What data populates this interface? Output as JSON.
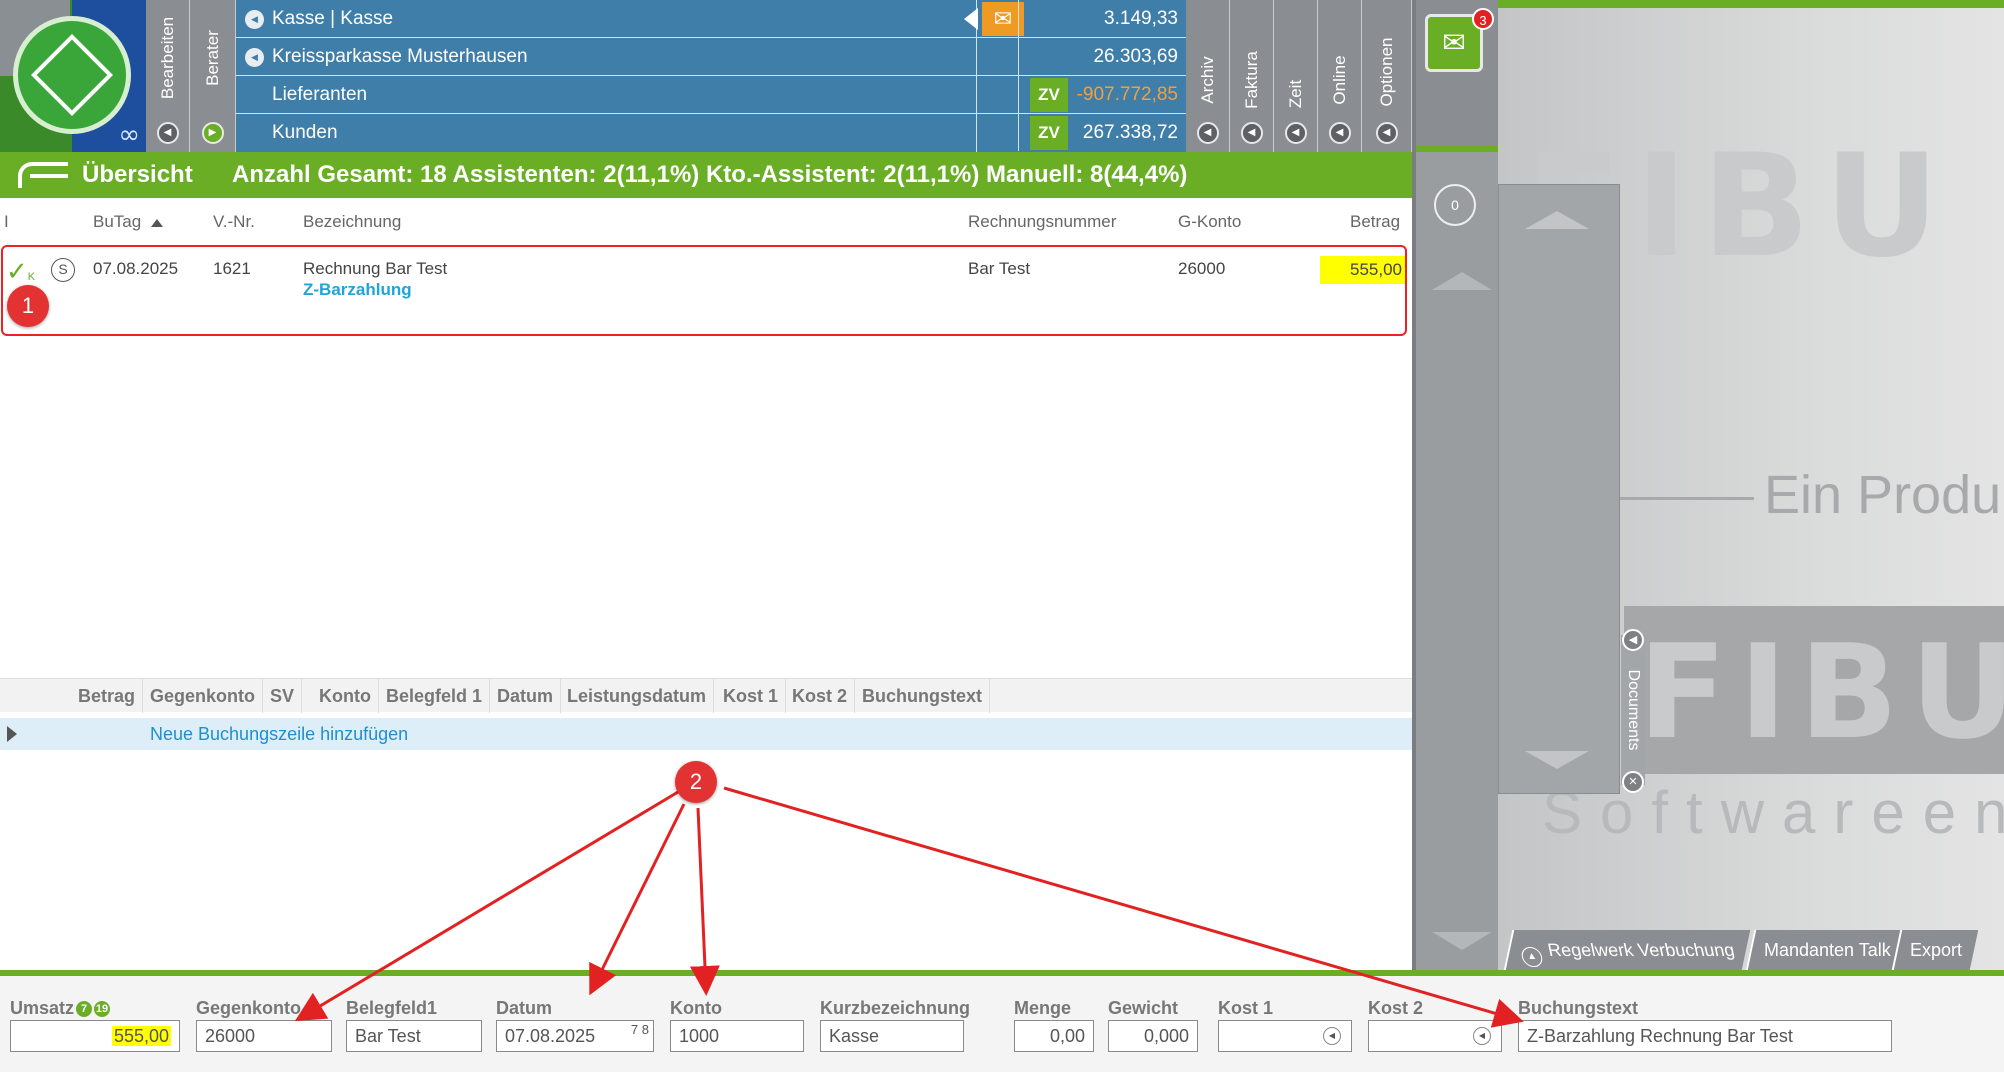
{
  "sidebar_tabs": [
    {
      "label": "Bearbeiten"
    },
    {
      "label": "Berater"
    }
  ],
  "accounts": [
    {
      "name": "Kasse | Kasse",
      "value": "3.149,33",
      "has_mail": true
    },
    {
      "name": "Kreissparkasse Musterhausen",
      "value": "26.303,69"
    },
    {
      "name": "Lieferanten",
      "value": "-907.772,85",
      "zv": "ZV"
    },
    {
      "name": "Kunden",
      "value": "267.338,72",
      "zv": "ZV"
    }
  ],
  "right_tabs": [
    {
      "label": "Archiv"
    },
    {
      "label": "Faktura"
    },
    {
      "label": "Zeit"
    },
    {
      "label": "Online"
    },
    {
      "label": "Optionen"
    }
  ],
  "inbox": {
    "badge": "3",
    "counter": "0"
  },
  "overview": {
    "title": "Übersicht",
    "stats": "Anzahl Gesamt: 18  Assistenten: 2(11,1%)  Kto.-Assistent: 2(11,1%)  Manuell: 8(44,4%)"
  },
  "table": {
    "headers": {
      "i": "I",
      "butag": "BuTag",
      "vnr": "V.-Nr.",
      "bezeichnung": "Bezeichnung",
      "rechnungsnummer": "Rechnungsnummer",
      "gkonto": "G-Konto",
      "betrag": "Betrag"
    },
    "rows": [
      {
        "status_mark": "✓K",
        "s": "S",
        "butag": "07.08.2025",
        "vnr": "1621",
        "bezeichnung": "Rechnung Bar Test",
        "sub": "Z-Barzahlung",
        "rechnungsnummer": "Bar Test",
        "gkonto": "26000",
        "betrag": "555,00"
      }
    ]
  },
  "booking_columns": [
    "Betrag",
    "Gegenkonto",
    "SV",
    "Konto",
    "Belegfeld 1",
    "Datum",
    "Leistungsdatum",
    "Kost 1",
    "Kost 2",
    "Buchungstext"
  ],
  "new_line_link": "Neue Buchungszeile hinzufügen",
  "form": {
    "umsatz": {
      "label": "Umsatz",
      "value": "555,00",
      "badge1": "7",
      "badge2": "19"
    },
    "gegenkonto": {
      "label": "Gegenkonto",
      "value": "26000"
    },
    "belegfeld1": {
      "label": "Belegfeld1",
      "value": "Bar Test"
    },
    "datum": {
      "label": "Datum",
      "value": "07.08.2025",
      "cal": "7 8"
    },
    "konto": {
      "label": "Konto",
      "value": "1000"
    },
    "kurzbezeichnung": {
      "label": "Kurzbezeichnung",
      "value": "Kasse"
    },
    "menge": {
      "label": "Menge",
      "value": "0,00"
    },
    "gewicht": {
      "label": "Gewicht",
      "value": "0,000"
    },
    "kost1": {
      "label": "Kost 1",
      "value": ""
    },
    "kost2": {
      "label": "Kost 2",
      "value": ""
    },
    "buchungstext": {
      "label": "Buchungstext",
      "value": "Z-Barzahlung Rechnung Bar Test"
    }
  },
  "bottom_tabs": [
    {
      "label": "Regelwerk Verbuchung"
    },
    {
      "label": "Mandanten Talk"
    },
    {
      "label": "Export"
    }
  ],
  "documents_tab": "Documents",
  "splash": {
    "brand": "FIBU",
    "tagline": "Ein Produ",
    "sub": "Softwareent"
  },
  "annotations": [
    "1",
    "2"
  ],
  "colors": {
    "green": "#6aae26",
    "blue": "#3f7ea9",
    "gray": "#8a8e92",
    "highlight": "#ffff00",
    "annotation_red": "#e22222"
  }
}
